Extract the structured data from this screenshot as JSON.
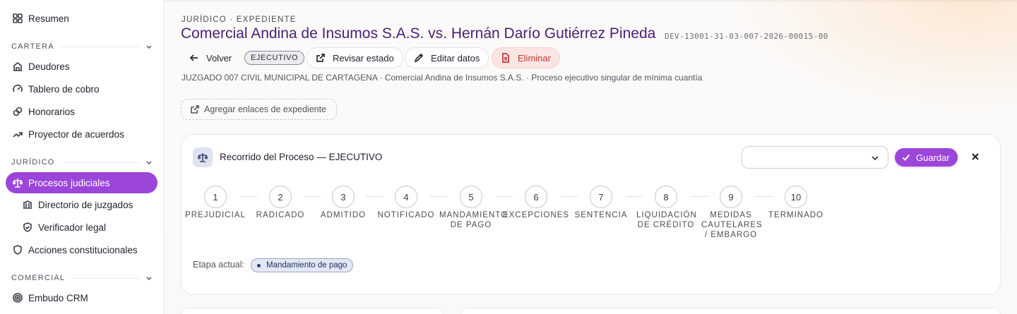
{
  "sidebar": {
    "resumen": {
      "label": "Resumen",
      "icon": "grid-icon"
    },
    "sections": {
      "cartera": "CARTERA",
      "juridico": "JURÍDICO",
      "comercial": "COMERCIAL"
    },
    "cartera_items": [
      {
        "label": "Deudores",
        "icon": "building-icon"
      },
      {
        "label": "Tablero de cobro",
        "icon": "gauge-icon"
      },
      {
        "label": "Honorarios",
        "icon": "coins-icon"
      },
      {
        "label": "Proyector de acuerdos",
        "icon": "trend-icon"
      }
    ],
    "juridico_items": [
      {
        "label": "Procesos judiciales",
        "icon": "scale-icon",
        "active": true
      },
      {
        "label": "Directorio de juzgados",
        "icon": "courthouse-icon"
      },
      {
        "label": "Verificador legal",
        "icon": "shield-check-icon"
      },
      {
        "label": "Acciones constitucionales",
        "icon": "shield-icon"
      }
    ],
    "comercial_items": [
      {
        "label": "Embudo CRM",
        "icon": "target-icon"
      }
    ],
    "active_color": "#9b45d9"
  },
  "header": {
    "eyebrow": "JURÍDICO · EXPEDIENTE",
    "title": "Comercial Andina de Insumos S.A.S. vs. Hernán Darío Gutiérrez Pineda",
    "case_id": "DEV-13001-31-03-007-2026-00015-00",
    "title_color": "#4a1e73"
  },
  "actions": {
    "back": "Volver",
    "badge": "EJECUTIVO",
    "review": "Revisar estado",
    "edit": "Editar datos",
    "delete": "Eliminar"
  },
  "meta": "JUZGADO 007 CIVIL MUNICIPAL DE CARTAGENA · Comercial Andina de Insumos S.A.S. · Proceso ejecutivo singular de mínima cuantía",
  "links_button": "Agregar enlaces de expediente",
  "process_card": {
    "title": "Recorrido del Proceso — EJECUTIVO",
    "select_value": "",
    "save": "Guardar",
    "steps": [
      {
        "n": "1",
        "label": "PREJUDICIAL"
      },
      {
        "n": "2",
        "label": "RADICADO"
      },
      {
        "n": "3",
        "label": "ADMITIDO"
      },
      {
        "n": "4",
        "label": "NOTIFICADO"
      },
      {
        "n": "5",
        "label": "MANDAMIENTO DE PAGO"
      },
      {
        "n": "6",
        "label": "EXCEPCIONES"
      },
      {
        "n": "7",
        "label": "SENTENCIA"
      },
      {
        "n": "8",
        "label": "LIQUIDACIÓN DE CRÉDITO"
      },
      {
        "n": "9",
        "label": "MEDIDAS CAUTELARES / EMBARGO"
      },
      {
        "n": "10",
        "label": "TERMINADO"
      }
    ],
    "current_label": "Etapa actual:",
    "current_stage": "Mandamiento de pago"
  }
}
